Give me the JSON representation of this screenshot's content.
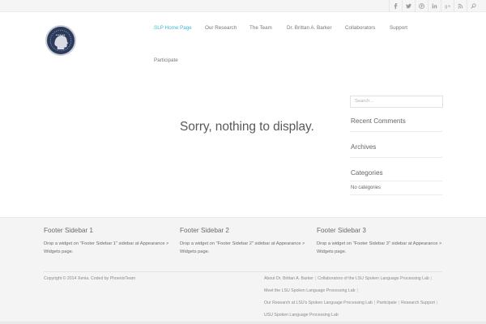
{
  "social": [
    "facebook-icon",
    "twitter-icon",
    "pinterest-icon",
    "linkedin-icon",
    "google-plus-icon",
    "rss-icon",
    "search-icon"
  ],
  "nav": {
    "items": [
      {
        "label": "SLP Home Page",
        "active": true
      },
      {
        "label": "Our Research"
      },
      {
        "label": "The Team"
      },
      {
        "label": "Dr. Brittan A. Barker"
      },
      {
        "label": "Collaborators"
      },
      {
        "label": "Support"
      },
      {
        "label": "Participate"
      }
    ]
  },
  "main": {
    "notice": "Sorry, nothing to display."
  },
  "sidebar": {
    "search_placeholder": "Search...",
    "recent_comments": "Recent Comments",
    "archives": "Archives",
    "categories": "Categories",
    "no_categories": "No categories"
  },
  "footer": {
    "sidebars": [
      {
        "title": "Footer Sidebar 1",
        "text": "Drop a widget on \"Footer Sidebar 1\" sidebar at Appearance > Widgets page."
      },
      {
        "title": "Footer Sidebar 2",
        "text": "Drop a widget on \"Footer Sidebar 2\" sidebar at Appearance > Widgets page."
      },
      {
        "title": "Footer Sidebar 3",
        "text": "Drop a widget on \"Footer Sidebar 3\" sidebar at Appearance > Widgets page."
      }
    ],
    "copyright": "Copyright © 2014 Xenia. Coded by PhoenixTeam",
    "links": [
      "About Dr. Brittan A. Barker",
      "Collaborators of the LSU Spoken Language Processing Lab",
      "Meet the LSU Spoken Language Processing Lab",
      "Our Research at LSU's Spoken Language Processing Lab",
      "Participate",
      "Research Support",
      "USU Spoken Language Processing Lab"
    ]
  },
  "colors": {
    "accent": "#3fb8d4",
    "footer_bg": "#f4f4f4"
  }
}
